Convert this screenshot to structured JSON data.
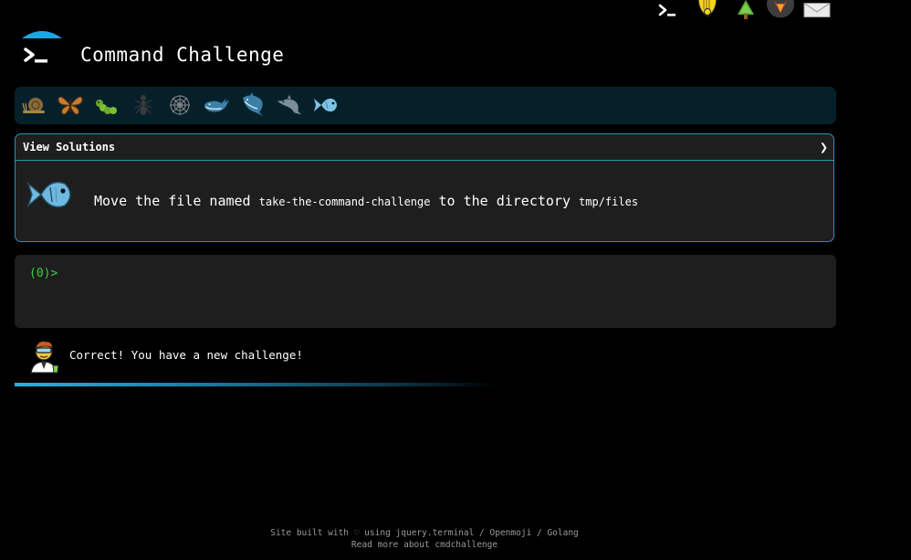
{
  "header": {
    "title": "Command Challenge",
    "logo_icon": "terminal-umbrella-icon"
  },
  "top_icons": [
    {
      "name": "terminal-icon"
    },
    {
      "name": "hand-medal-icon"
    },
    {
      "name": "tree-icon"
    },
    {
      "name": "gitlab-fox-icon"
    },
    {
      "name": "envelope-icon"
    }
  ],
  "creatures": [
    {
      "name": "snail-icon",
      "color": "#8a6a3a"
    },
    {
      "name": "butterfly-icon",
      "color": "#c87d2e"
    },
    {
      "name": "caterpillar-icon",
      "color": "#6fa82d"
    },
    {
      "name": "ant-icon",
      "color": "#3a3a3a"
    },
    {
      "name": "spider-web-icon",
      "color": "#8c8c8c"
    },
    {
      "name": "whale-icon",
      "color": "#3c7fa6"
    },
    {
      "name": "shark-icon",
      "color": "#3c7fa6"
    },
    {
      "name": "dolphin-icon",
      "color": "#7b8d98"
    },
    {
      "name": "fish-icon",
      "color": "#7ec3e6"
    }
  ],
  "challenge": {
    "solutions_label": "View Solutions",
    "chevron": "❯",
    "task_pre": "Move the file named",
    "task_file": "take-the-command-challenge",
    "task_mid": "to the directory",
    "task_dir": "tmp/files"
  },
  "terminal": {
    "prompt": "(0)>"
  },
  "feedback": {
    "message": "Correct! You have a new challenge!"
  },
  "progress": {
    "fraction": 0.59
  },
  "footer": {
    "line1_prefix": "Site built with ♡ using",
    "link_jquery": "jquery.terminal",
    "sep1": " / ",
    "link_openmoji": "Openmoji",
    "sep2": " / ",
    "link_golang": "Golang",
    "line2": "Read more about cmdchallenge"
  },
  "colors": {
    "accent": "#2a93b4",
    "prompt": "#38d23d",
    "creature_bar_bg": "#06202a"
  }
}
